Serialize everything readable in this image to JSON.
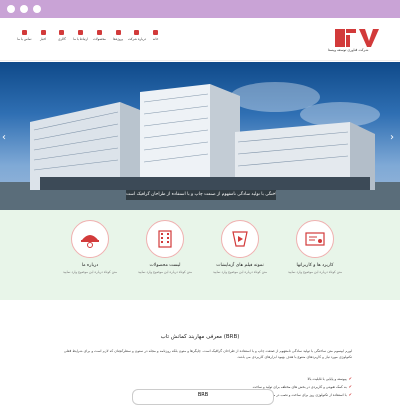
{
  "brand": {
    "logo_text": "FTV",
    "tagline": "شرکت فناوری توسعه ویستا"
  },
  "nav": {
    "items": [
      {
        "label": "خانه",
        "icon": "home-icon"
      },
      {
        "label": "درباره شرکت",
        "icon": "info-icon"
      },
      {
        "label": "پروژه‌ها",
        "icon": "project-icon"
      },
      {
        "label": "محصولات",
        "icon": "product-icon"
      },
      {
        "label": "ارتباط با ما",
        "icon": "contact-icon"
      },
      {
        "label": "گالری",
        "icon": "gallery-icon"
      },
      {
        "label": "اخبار",
        "icon": "news-icon"
      },
      {
        "label": "تماس با ما",
        "icon": "phone-icon"
      }
    ]
  },
  "hero": {
    "caption": "لورم ایپسوم متن ساختگی با تولید سادگی نامفهوم از صنعت چاپ و با استفاده از طراحان گرافیک است"
  },
  "features": [
    {
      "title": "کاربرد ها و کاربرانها",
      "text": "متن کوتاه درباره این موضوع وارد نمایید",
      "icon": "certificate-icon"
    },
    {
      "title": "نمونه فیلم های آزمایشات",
      "text": "متن کوتاه درباره این موضوع وارد نمایید",
      "icon": "video-icon"
    },
    {
      "title": "لیست محصولات",
      "text": "متن کوتاه درباره این موضوع وارد نمایید",
      "icon": "building-icon"
    },
    {
      "title": "درباره ما",
      "text": "متن کوتاه درباره این موضوع وارد نمایید",
      "icon": "helmet-gear-icon"
    }
  ],
  "content": {
    "title": "معرفی مهاربند کمانش تاب (BRB)",
    "paragraph": "لورم ایپسوم متن ساختگی با تولید سادگی نامفهوم از صنعت چاپ و با استفاده از طراحان گرافیک است. چاپگرها و متون بلکه روزنامه و مجله در ستون و سطرآنچنان که لازم است و برای شرایط فعلی تکنولوژی مورد نیاز و کاربردهای متنوع با هدف بهبود ابزارهای کاربردی می باشد.",
    "bullets": [
      "پیوسته و پایایی با قابلیت بالا",
      "به کمک تقویتی و کاربردی در بخش های مختلف برای تولید و ساخت",
      "با استفاده از تکنولوژی روز برای ساخت و نصب در مکان مورد نیاز"
    ],
    "tab_label": "BRB"
  }
}
